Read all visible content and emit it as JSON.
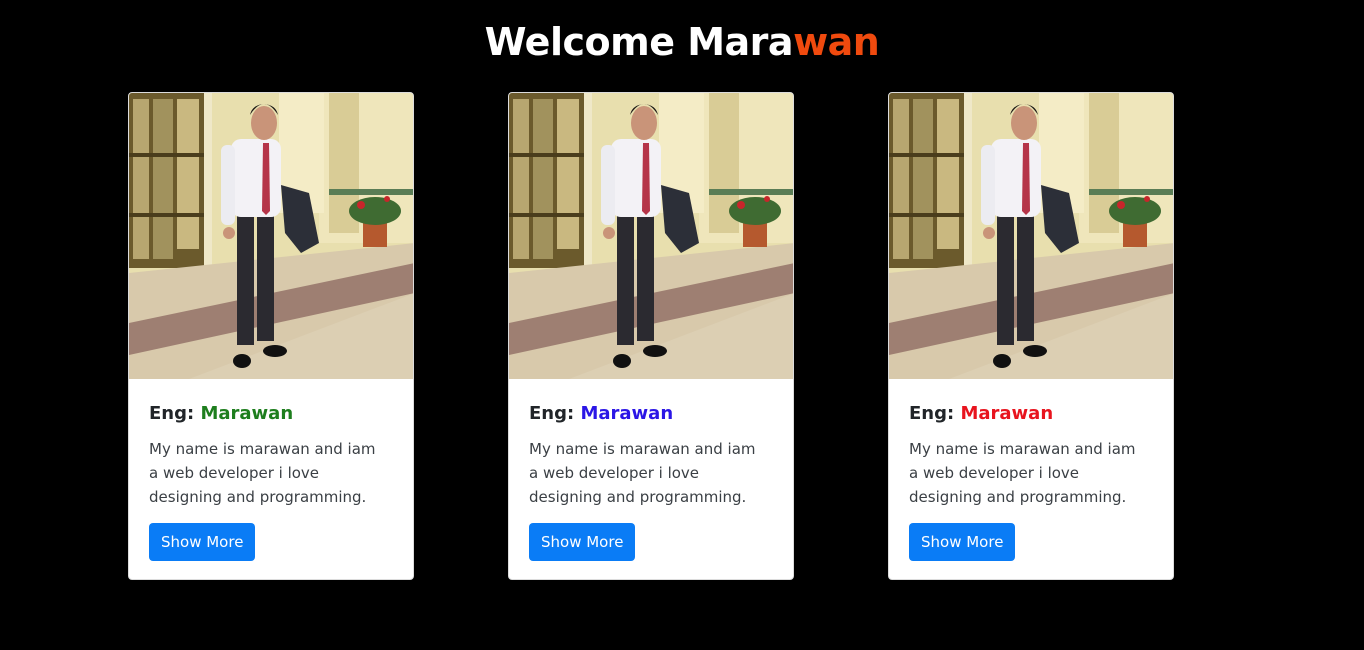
{
  "heading": {
    "part1": "Welcome Mara",
    "part2": "wan"
  },
  "cards": [
    {
      "prefix": "Eng: ",
      "name": "Marawan",
      "name_color": "#1e7e1e",
      "text": "My name is marawan and iam a web developer i love designing and programming.",
      "button": "Show More"
    },
    {
      "prefix": "Eng: ",
      "name": "Marawan",
      "name_color": "#2b16e6",
      "text": "My name is marawan and iam a web developer i love designing and programming.",
      "button": "Show More"
    },
    {
      "prefix": "Eng: ",
      "name": "Marawan",
      "name_color": "#e8141e",
      "text": "My name is marawan and iam a web developer i love designing and programming.",
      "button": "Show More"
    }
  ],
  "colors": {
    "background": "#000000",
    "heading_accent": "#f04a0e",
    "button": "#0a7cf6"
  }
}
